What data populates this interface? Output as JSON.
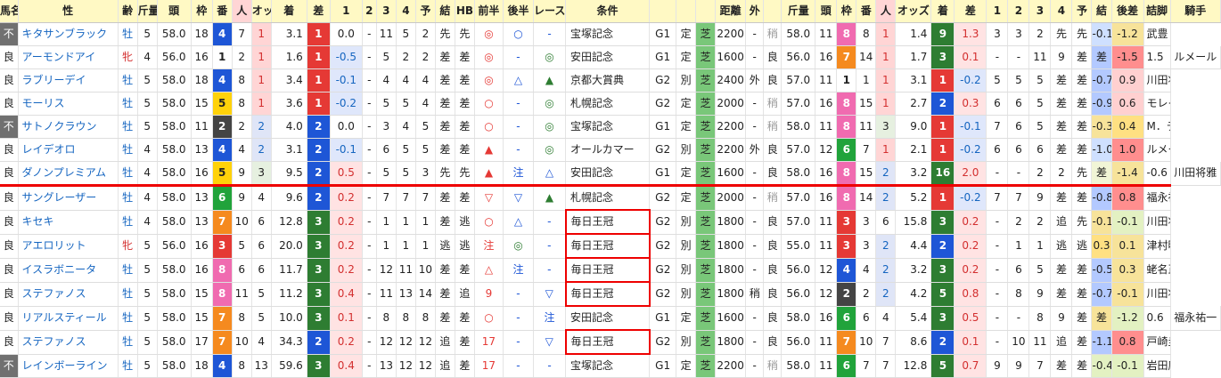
{
  "headers": [
    "馬名",
    "性",
    "齢",
    "斤量",
    "頭",
    "枠",
    "番",
    "人",
    "オッズ",
    "着",
    "差",
    "1",
    "2",
    "3",
    "4",
    "予",
    "結",
    "HB",
    "前半",
    "後半",
    "レース名",
    "条件",
    "",
    "",
    "",
    "距離",
    "外",
    "",
    "斤量",
    "頭",
    "枠",
    "番",
    "人",
    "オッズ",
    "着",
    "差",
    "1",
    "2",
    "3",
    "4",
    "予",
    "結",
    "後差",
    "詰脚",
    "騎手"
  ],
  "rows": [
    [
      "不",
      "キタサンブラック",
      "牡",
      "5",
      "58.0",
      "18",
      "4",
      "7",
      "1",
      "3.1",
      "1",
      "0.0",
      "-",
      "11",
      "5",
      "2",
      "先",
      "先",
      "◎",
      "○",
      "-",
      "宝塚記念",
      "G1",
      "定",
      "芝",
      "2200",
      "-",
      "稍",
      "58.0",
      "11",
      "8",
      "8",
      "1",
      "1.4",
      "9",
      "1.3",
      "3",
      "3",
      "2",
      "先",
      "先",
      "-0.1",
      "-1.2",
      "武豊"
    ],
    [
      "良",
      "アーモンドアイ",
      "牝",
      "4",
      "56.0",
      "16",
      "1",
      "2",
      "1",
      "1.6",
      "1",
      "-0.5",
      "-",
      "5",
      "2",
      "2",
      "差",
      "差",
      "◎",
      "-",
      "◎",
      "安田記念",
      "G1",
      "定",
      "芝",
      "1600",
      "-",
      "良",
      "56.0",
      "16",
      "7",
      "14",
      "1",
      "1.7",
      "3",
      "0.1",
      "-",
      "-",
      "11",
      "9",
      "差",
      "差",
      "-1.5",
      "1.5",
      "ルメール"
    ],
    [
      "良",
      "ラブリーデイ",
      "牡",
      "5",
      "58.0",
      "18",
      "4",
      "8",
      "1",
      "3.4",
      "1",
      "-0.1",
      "-",
      "4",
      "4",
      "4",
      "差",
      "差",
      "◎",
      "△",
      "▲",
      "京都大賞典",
      "G2",
      "別",
      "芝",
      "2400",
      "外",
      "良",
      "57.0",
      "11",
      "1",
      "1",
      "1",
      "3.1",
      "1",
      "-0.2",
      "5",
      "5",
      "5",
      "差",
      "差",
      "-0.7",
      "0.9",
      "川田将雅"
    ],
    [
      "良",
      "モーリス",
      "牡",
      "5",
      "58.0",
      "15",
      "5",
      "8",
      "1",
      "3.6",
      "1",
      "-0.2",
      "-",
      "5",
      "5",
      "4",
      "差",
      "差",
      "○",
      "-",
      "◎",
      "札幌記念",
      "G2",
      "定",
      "芝",
      "2000",
      "-",
      "稍",
      "57.0",
      "16",
      "8",
      "15",
      "1",
      "2.7",
      "2",
      "0.3",
      "6",
      "6",
      "5",
      "差",
      "差",
      "-0.9",
      "0.6",
      "モレイラ"
    ],
    [
      "不",
      "サトノクラウン",
      "牡",
      "5",
      "58.0",
      "11",
      "2",
      "2",
      "2",
      "4.0",
      "2",
      "0.0",
      "-",
      "3",
      "4",
      "5",
      "差",
      "差",
      "○",
      "-",
      "◎",
      "宝塚記念",
      "G1",
      "定",
      "芝",
      "2200",
      "-",
      "稍",
      "58.0",
      "11",
      "8",
      "11",
      "3",
      "9.0",
      "1",
      "-0.1",
      "7",
      "6",
      "5",
      "差",
      "差",
      "-0.3",
      "0.4",
      "M．デム"
    ],
    [
      "良",
      "レイデオロ",
      "牡",
      "4",
      "58.0",
      "13",
      "4",
      "4",
      "2",
      "3.1",
      "2",
      "-0.1",
      "-",
      "6",
      "5",
      "5",
      "差",
      "差",
      "▲",
      "-",
      "◎",
      "オールカマー",
      "G2",
      "別",
      "芝",
      "2200",
      "外",
      "良",
      "57.0",
      "12",
      "6",
      "7",
      "1",
      "2.1",
      "1",
      "-0.2",
      "6",
      "6",
      "6",
      "差",
      "差",
      "-1.0",
      "1.0",
      "ルメール"
    ],
    [
      "良",
      "ダノンプレミアム",
      "牡",
      "4",
      "58.0",
      "16",
      "5",
      "9",
      "3",
      "9.5",
      "2",
      "0.5",
      "-",
      "5",
      "5",
      "3",
      "先",
      "先",
      "▲",
      "注",
      "△",
      "安田記念",
      "G1",
      "定",
      "芝",
      "1600",
      "-",
      "良",
      "58.0",
      "16",
      "8",
      "15",
      "2",
      "3.2",
      "16",
      "2.0",
      "-",
      "-",
      "2",
      "2",
      "先",
      "差",
      "-1.4",
      "-0.6",
      "川田将雅"
    ],
    [
      "良",
      "サングレーザー",
      "牡",
      "4",
      "58.0",
      "13",
      "6",
      "9",
      "4",
      "9.6",
      "2",
      "0.2",
      "-",
      "7",
      "7",
      "7",
      "差",
      "差",
      "▽",
      "▽",
      "▲",
      "札幌記念",
      "G2",
      "定",
      "芝",
      "2000",
      "-",
      "稍",
      "57.0",
      "16",
      "8",
      "14",
      "2",
      "5.2",
      "1",
      "-0.2",
      "7",
      "7",
      "9",
      "差",
      "差",
      "-0.8",
      "0.8",
      "福永祐一"
    ],
    [
      "良",
      "キセキ",
      "牡",
      "4",
      "58.0",
      "13",
      "7",
      "10",
      "6",
      "12.8",
      "3",
      "0.2",
      "-",
      "1",
      "1",
      "1",
      "差",
      "逃",
      "○",
      "△",
      "-",
      "毎日王冠",
      "G2",
      "別",
      "芝",
      "1800",
      "-",
      "良",
      "57.0",
      "11",
      "3",
      "3",
      "6",
      "15.8",
      "3",
      "0.2",
      "-",
      "2",
      "2",
      "追",
      "先",
      "-0.1",
      "-0.1",
      "川田将雅"
    ],
    [
      "良",
      "アエロリット",
      "牝",
      "5",
      "56.0",
      "16",
      "3",
      "5",
      "6",
      "20.0",
      "3",
      "0.2",
      "-",
      "1",
      "1",
      "1",
      "逃",
      "逃",
      "注",
      "◎",
      "-",
      "毎日王冠",
      "G2",
      "別",
      "芝",
      "1800",
      "-",
      "良",
      "55.0",
      "11",
      "3",
      "3",
      "2",
      "4.4",
      "2",
      "0.2",
      "-",
      "1",
      "1",
      "逃",
      "逃",
      "0.3",
      "0.1",
      "津村明秀"
    ],
    [
      "良",
      "イスラボニータ",
      "牡",
      "5",
      "58.0",
      "16",
      "8",
      "6",
      "6",
      "11.7",
      "3",
      "0.2",
      "-",
      "12",
      "11",
      "10",
      "差",
      "差",
      "△",
      "注",
      "-",
      "毎日王冠",
      "G2",
      "別",
      "芝",
      "1800",
      "-",
      "良",
      "56.0",
      "12",
      "4",
      "4",
      "2",
      "3.2",
      "3",
      "0.2",
      "-",
      "6",
      "5",
      "差",
      "差",
      "-0.5",
      "0.3",
      "蛯名正義"
    ],
    [
      "良",
      "ステファノス",
      "牡",
      "5",
      "58.0",
      "15",
      "8",
      "11",
      "5",
      "11.2",
      "3",
      "0.4",
      "-",
      "11",
      "13",
      "14",
      "差",
      "追",
      "9",
      "-",
      "▽",
      "毎日王冠",
      "G2",
      "別",
      "芝",
      "1800",
      "稍",
      "良",
      "56.0",
      "12",
      "2",
      "2",
      "2",
      "4.2",
      "5",
      "0.8",
      "-",
      "8",
      "9",
      "差",
      "差",
      "-0.7",
      "-0.1",
      "川田将雅"
    ],
    [
      "良",
      "リアルスティール",
      "牡",
      "5",
      "58.0",
      "15",
      "7",
      "8",
      "5",
      "10.0",
      "3",
      "0.1",
      "-",
      "8",
      "8",
      "8",
      "差",
      "差",
      "○",
      "-",
      "注",
      "安田記念",
      "G1",
      "定",
      "芝",
      "1600",
      "-",
      "良",
      "58.0",
      "16",
      "6",
      "6",
      "4",
      "5.4",
      "3",
      "0.5",
      "-",
      "-",
      "8",
      "9",
      "差",
      "差",
      "-1.2",
      "0.6",
      "福永祐一"
    ],
    [
      "良",
      "ステファノス",
      "牡",
      "5",
      "58.0",
      "17",
      "7",
      "10",
      "4",
      "34.3",
      "2",
      "0.2",
      "-",
      "12",
      "12",
      "12",
      "追",
      "差",
      "17",
      "-",
      "▽",
      "毎日王冠",
      "G2",
      "別",
      "芝",
      "1800",
      "-",
      "良",
      "56.0",
      "11",
      "7",
      "10",
      "7",
      "8.6",
      "2",
      "0.1",
      "-",
      "10",
      "11",
      "追",
      "差",
      "-1.1",
      "0.8",
      "戸崎圭太"
    ],
    [
      "不",
      "レインボーライン",
      "牡",
      "5",
      "58.0",
      "18",
      "4",
      "8",
      "13",
      "59.6",
      "3",
      "0.4",
      "-",
      "13",
      "12",
      "12",
      "追",
      "差",
      "17",
      "-",
      "-",
      "宝塚記念",
      "G1",
      "定",
      "芝",
      "2200",
      "-",
      "稍",
      "58.0",
      "11",
      "6",
      "7",
      "7",
      "12.8",
      "5",
      "0.7",
      "9",
      "9",
      "7",
      "差",
      "差",
      "-0.4",
      "-0.1",
      "岩田康誠"
    ]
  ],
  "boxed_rows": [
    8,
    9,
    10,
    11,
    13
  ]
}
